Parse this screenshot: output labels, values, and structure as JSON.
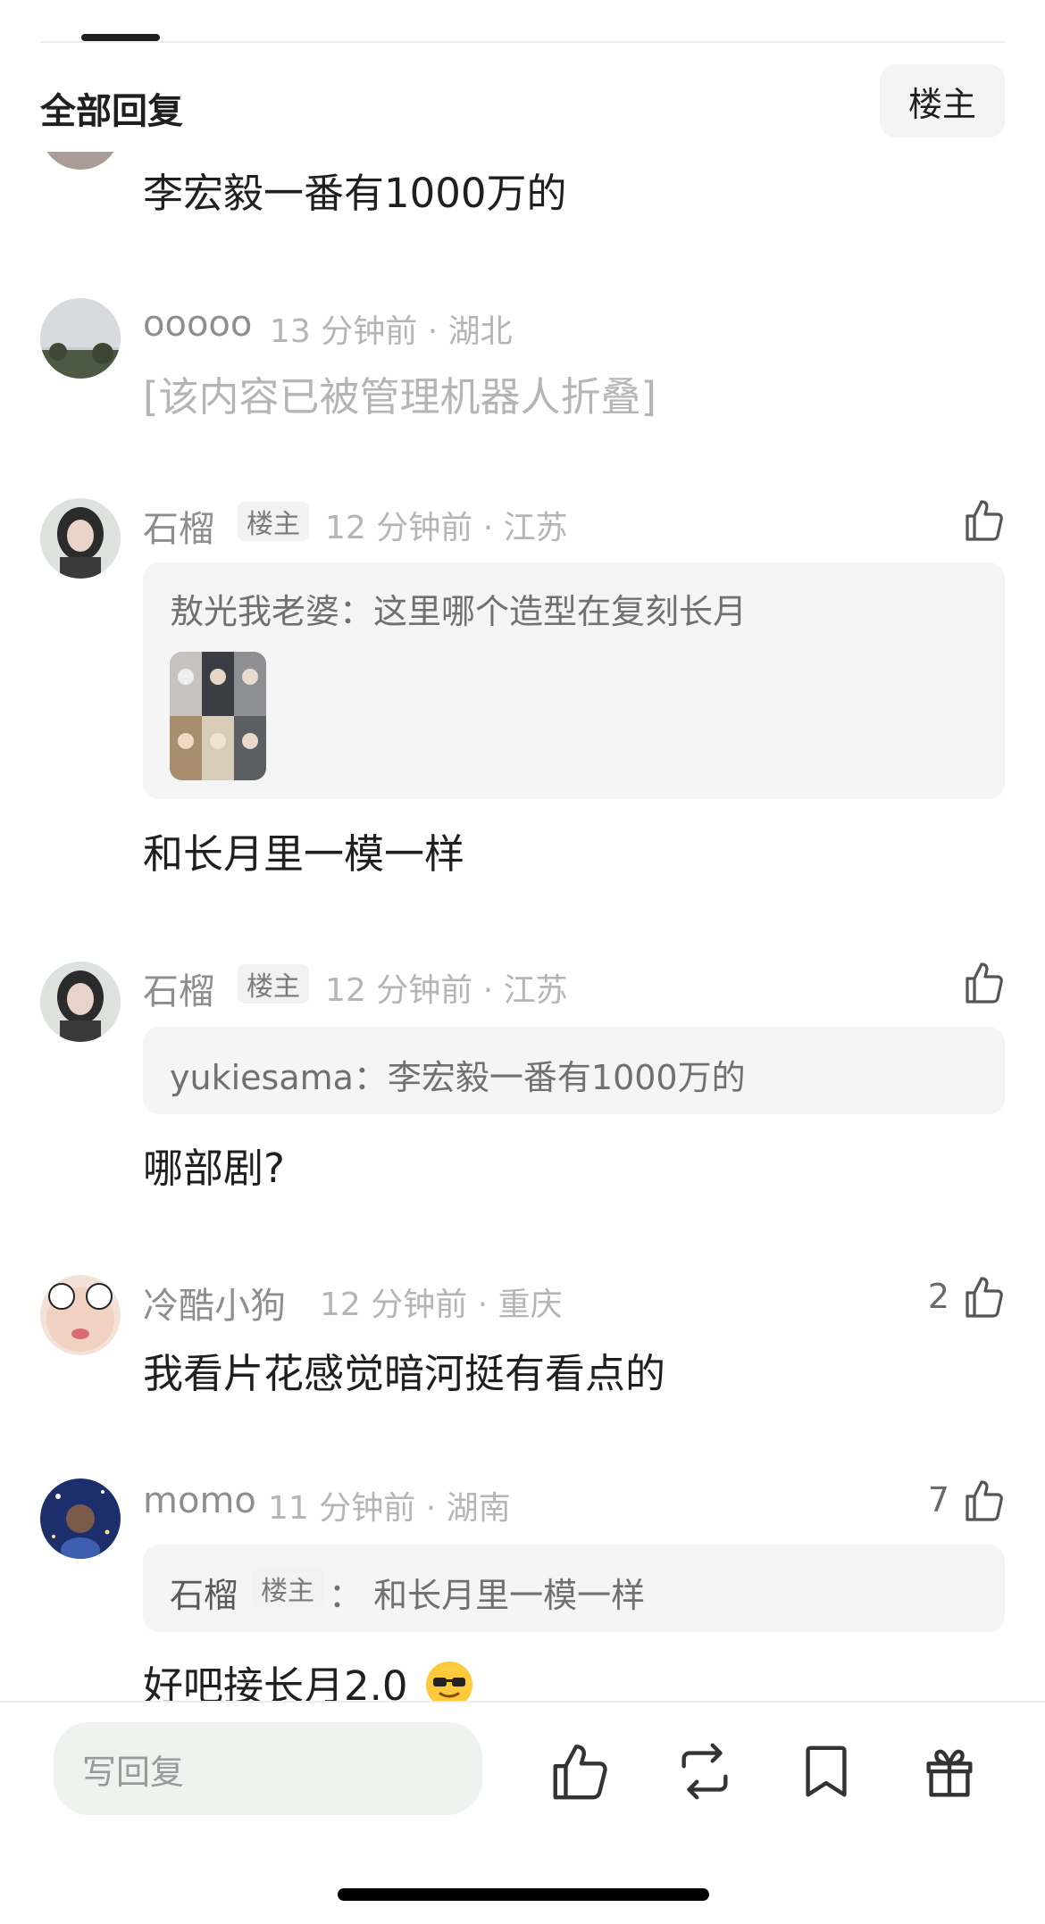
{
  "section": {
    "title": "全部回复",
    "filter_label": "楼主"
  },
  "comments": [
    {
      "body": "李宏毅一番有1000万的"
    },
    {
      "username": "ooooo",
      "meta": "13 分钟前 · 湖北",
      "folded": "[该内容已被管理机器人折叠]"
    },
    {
      "username": "石榴",
      "badge": "楼主",
      "meta": "12 分钟前 · 江苏",
      "quote": "敖光我老婆：这里哪个造型在复刻长月",
      "body": "和长月里一模一样"
    },
    {
      "username": "石榴",
      "badge": "楼主",
      "meta": "12 分钟前 · 江苏",
      "quote": "yukiesama：李宏毅一番有1000万的",
      "body": "哪部剧?"
    },
    {
      "username": "冷酷小狗",
      "meta": "12 分钟前 · 重庆",
      "likes": "2",
      "body": "我看片花感觉暗河挺有看点的"
    },
    {
      "username": "momo",
      "meta": "11 分钟前 · 湖南",
      "likes": "7",
      "quote_user": "石榴",
      "quote_badge": "楼主",
      "quote_text": "：  和长月里一模一样",
      "body": "好吧接长月2.0"
    }
  ],
  "bottom_bar": {
    "reply_placeholder": "写回复"
  },
  "icons": {
    "like": "thumbs-up-icon",
    "repost": "repost-icon",
    "bookmark": "bookmark-icon",
    "gift": "gift-icon",
    "emoji": "sunglasses-emoji-icon"
  },
  "colors": {
    "text": "#1f1f1f",
    "muted": "#8e8e8e",
    "light": "#b5b5b5",
    "quote_bg": "#f5f5f5",
    "input_bg": "#eef3ef"
  }
}
